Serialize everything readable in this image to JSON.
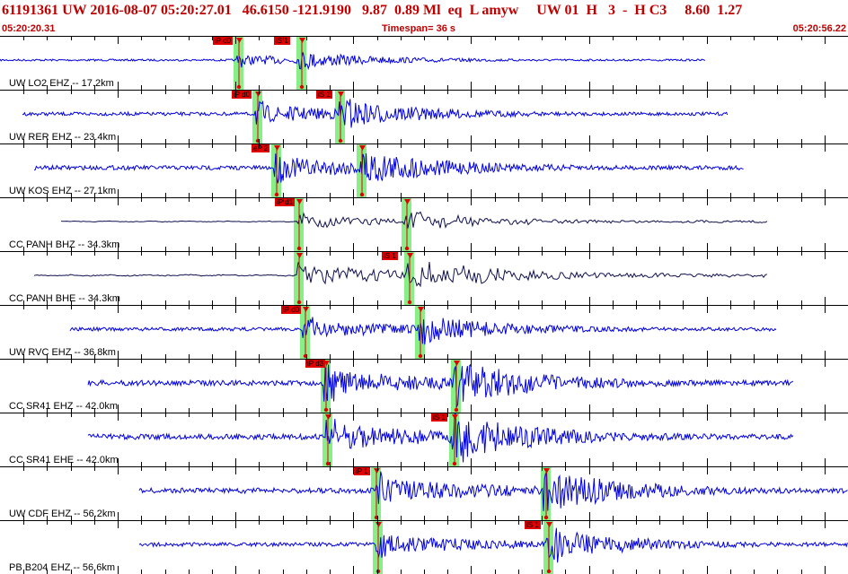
{
  "header": {
    "event_line": "61191361 UW 2016-08-07 05:20:27.01   46.6150 -121.9190   9.87  0.89 Ml  eq  L amyw     UW 01  H   3  -  H C3     8.60  1.27",
    "start_time": "05:20:20.31",
    "timespan": "Timespan=  36 s",
    "end_time": "05:20:56.22"
  },
  "colors": {
    "trace_blue": "#0000e0",
    "trace_navy": "#101050",
    "pick_red": "#e00000",
    "window_green": "#88ee88",
    "header_red": "#c00000"
  },
  "traces": [
    {
      "label": "UW LO2 EHZ -- 17.2km",
      "color": "blue",
      "start": 0,
      "end": 785,
      "p": 263,
      "s": 333,
      "amp": 9,
      "picks": [
        {
          "text": "iP d0",
          "at": 237
        },
        {
          "text": "iS 1",
          "at": 305
        }
      ]
    },
    {
      "label": "UW RER EHZ -- 23.4km",
      "color": "blue",
      "start": 25,
      "end": 810,
      "p": 284,
      "s": 376,
      "amp": 16,
      "picks": [
        {
          "text": "iP d0",
          "at": 258
        },
        {
          "text": "iS 1",
          "at": 352
        }
      ]
    },
    {
      "label": "UW KOS EHZ -- 27.1km",
      "color": "blue",
      "start": 38,
      "end": 828,
      "p": 305,
      "s": 400,
      "amp": 20,
      "picks": [
        {
          "text": "eP 2",
          "at": 280
        }
      ]
    },
    {
      "label": "CC PANH BHZ -- 34.3km",
      "color": "navy",
      "start": 68,
      "end": 855,
      "p": 330,
      "s": 450,
      "amp": 13,
      "picks": [
        {
          "text": "iP d1",
          "at": 306
        }
      ]
    },
    {
      "label": "CC PANH BHE -- 34.3km",
      "color": "navy",
      "start": 38,
      "end": 855,
      "p": 330,
      "s": 453,
      "amp": 22,
      "picks": [
        {
          "text": "iS 1",
          "at": 425
        }
      ]
    },
    {
      "label": "UW RVC EHZ -- 36.8km",
      "color": "blue",
      "start": 78,
      "end": 865,
      "p": 337,
      "s": 465,
      "amp": 16,
      "picks": [
        {
          "text": "iP d0",
          "at": 313
        }
      ]
    },
    {
      "label": "CC SR41 EHZ -- 42.0km",
      "color": "blue",
      "start": 98,
      "end": 884,
      "p": 360,
      "s": 505,
      "amp": 24,
      "picks": [
        {
          "text": "iP d3",
          "at": 340
        }
      ]
    },
    {
      "label": "CC SR41 EHE -- 42.0km",
      "color": "blue",
      "start": 98,
      "end": 884,
      "p": 362,
      "s": 503,
      "amp": 25,
      "picks": [
        {
          "text": "iS 1",
          "at": 480
        }
      ]
    },
    {
      "label": "UW CDF EHZ -- 56.2km",
      "color": "blue",
      "start": 155,
      "end": 944,
      "p": 416,
      "s": 605,
      "amp": 24,
      "picks": [
        {
          "text": "iP 1",
          "at": 394
        }
      ]
    },
    {
      "label": "PB B204 EHZ -- 56.6km",
      "color": "blue",
      "start": 155,
      "end": 944,
      "p": 418,
      "s": 608,
      "amp": 18,
      "picks": [
        {
          "text": "iS 1",
          "at": 584
        }
      ]
    }
  ]
}
